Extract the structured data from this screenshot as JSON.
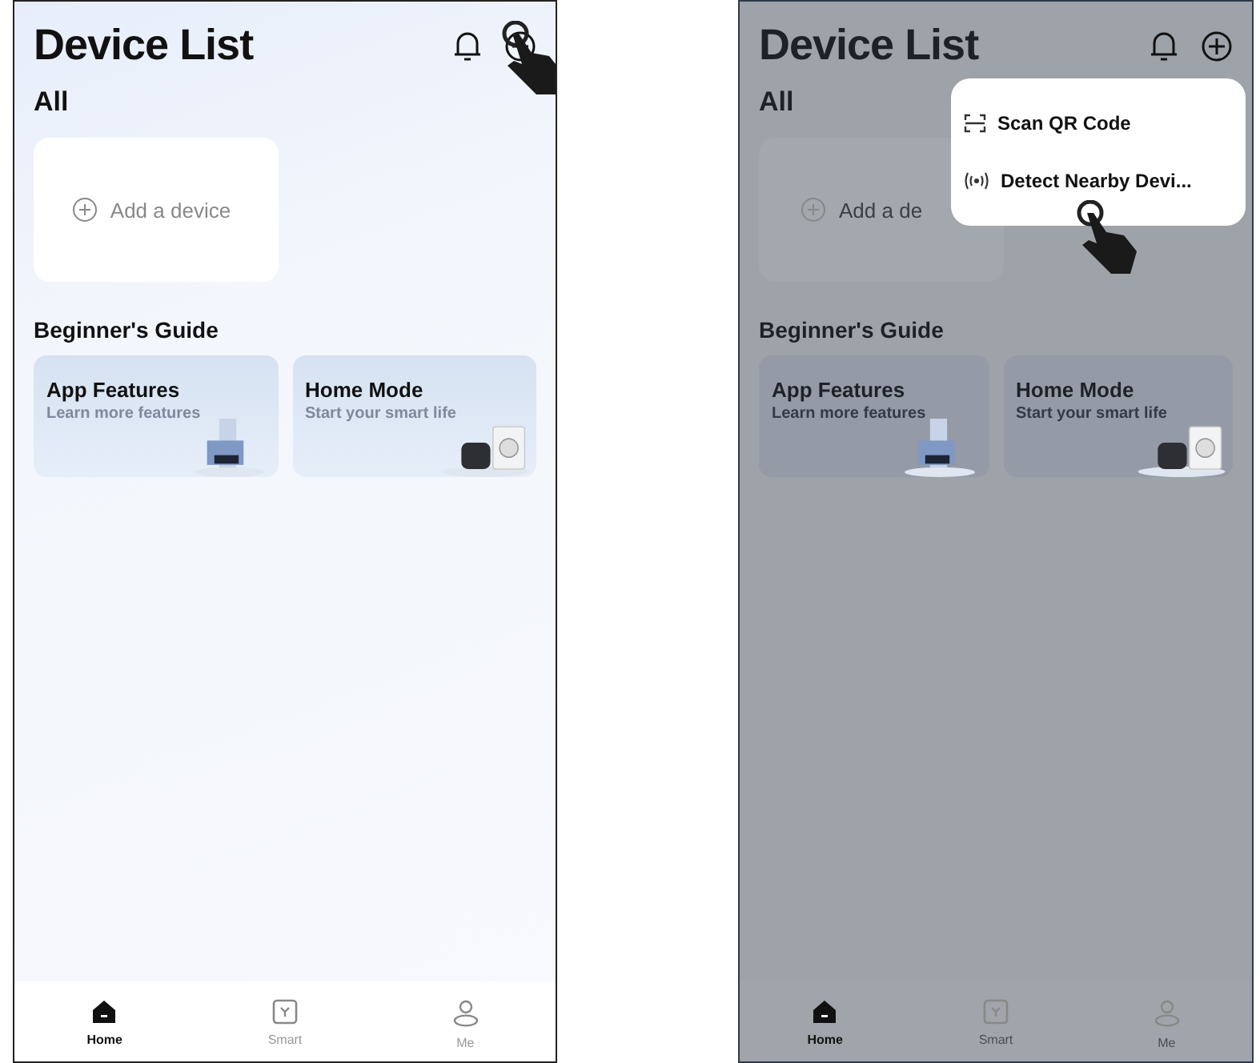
{
  "screens": [
    {
      "title": "Device List",
      "dimmed": false,
      "section": "All",
      "add_label": "Add a device",
      "guide_title": "Beginner's Guide",
      "cards": [
        {
          "kind": "features",
          "title": "App Features",
          "subtitle": "Learn more features"
        },
        {
          "kind": "home",
          "title": "Home Mode",
          "subtitle": "Start your smart life"
        }
      ],
      "tabs": [
        {
          "kind": "home",
          "label": "Home",
          "selected": true
        },
        {
          "kind": "smart",
          "label": "Smart",
          "selected": false
        },
        {
          "kind": "me",
          "label": "Me",
          "selected": false
        }
      ]
    },
    {
      "title": "Device List",
      "dimmed": true,
      "section": "All",
      "add_label": "Add a de",
      "guide_title": "Beginner's Guide",
      "cards": [
        {
          "kind": "features",
          "title": "App Features",
          "subtitle": "Learn more features"
        },
        {
          "kind": "home",
          "title": "Home Mode",
          "subtitle": "Start your smart life"
        }
      ],
      "tabs": [
        {
          "kind": "home",
          "label": "Home",
          "selected": true
        },
        {
          "kind": "smart",
          "label": "Smart",
          "selected": false
        },
        {
          "kind": "me",
          "label": "Me",
          "selected": false
        }
      ],
      "menu": [
        {
          "kind": "scan",
          "label": "Scan QR Code"
        },
        {
          "kind": "detect",
          "label": "Detect Nearby Devi..."
        }
      ]
    }
  ]
}
